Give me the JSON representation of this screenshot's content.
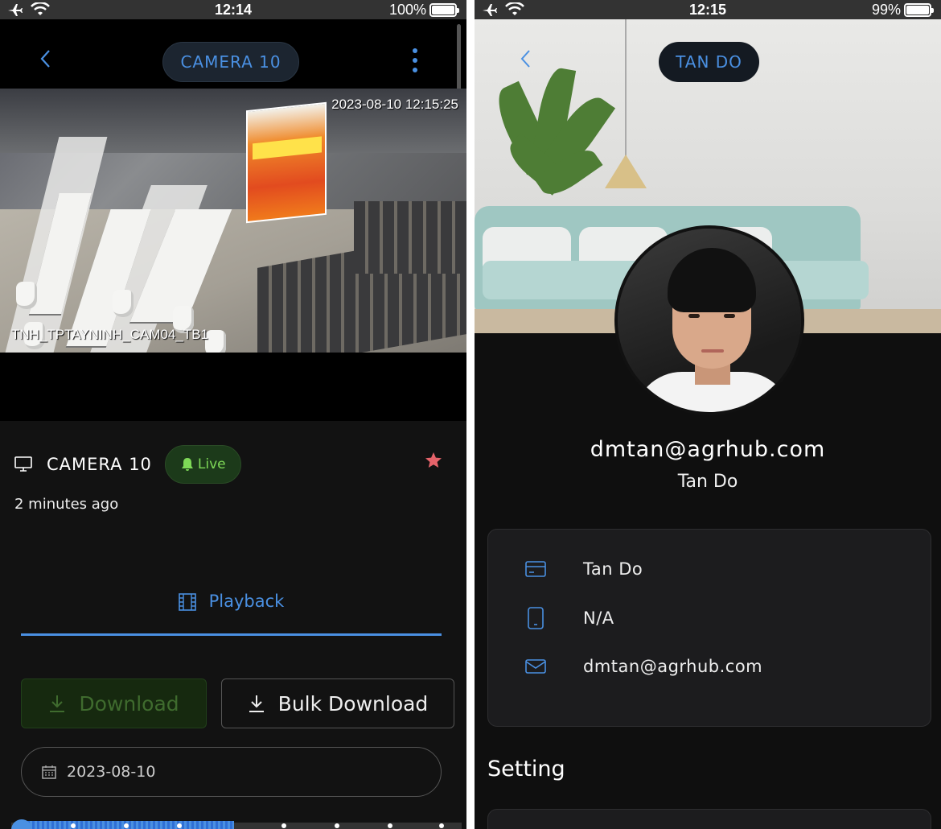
{
  "left": {
    "status": {
      "time": "12:14",
      "battery_text": "100%",
      "battery_level": 1.0
    },
    "header": {
      "title": "CAMERA 10"
    },
    "video": {
      "timestamp": "2023-08-10 12:15:25",
      "camera_label": "TNH_TPTAYNINH_CAM04_TB1"
    },
    "camera": {
      "name": "CAMERA 10",
      "live_label": "Live",
      "updated": "2 minutes ago"
    },
    "tab": {
      "label": "Playback"
    },
    "buttons": {
      "download": "Download",
      "bulk_download": "Bulk Download"
    },
    "date_field": {
      "value": "2023-08-10"
    },
    "timeline": {
      "progress": 0.48
    },
    "colors": {
      "accent": "#4a90e2",
      "live": "#7ed957",
      "star": "#e5636a"
    }
  },
  "right": {
    "status": {
      "time": "12:15",
      "battery_text": "99%",
      "battery_level": 0.99
    },
    "header": {
      "title": "TAN DO"
    },
    "profile": {
      "email": "dmtan@agrhub.com",
      "name": "Tan Do"
    },
    "details": [
      {
        "icon": "card-icon",
        "value": "Tan Do"
      },
      {
        "icon": "phone-icon",
        "value": "N/A"
      },
      {
        "icon": "mail-icon",
        "value": "dmtan@agrhub.com"
      }
    ],
    "setting": {
      "title": "Setting"
    }
  }
}
